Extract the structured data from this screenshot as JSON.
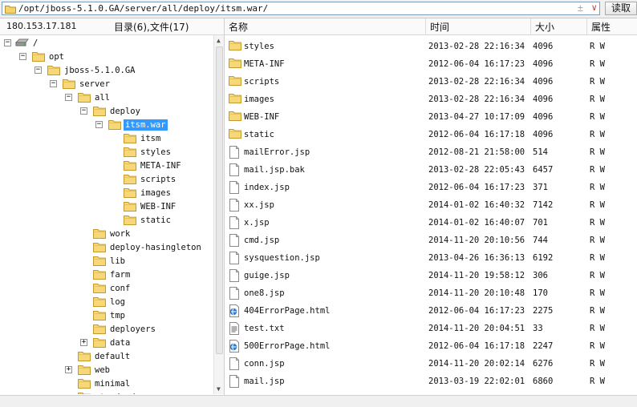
{
  "address": {
    "path": "/opt/jboss-5.1.0.GA/server/all/deploy/itsm.war/",
    "plusminus": "±",
    "dropdown": "∨"
  },
  "read_button": "读取",
  "left_header": {
    "ip": "180.153.17.181",
    "summary": "目录(6),文件(17)"
  },
  "columns": {
    "name": "名称",
    "time": "时间",
    "size": "大小",
    "attr": "属性"
  },
  "tree": [
    {
      "label": "/",
      "depth": 0,
      "exp": "-",
      "icon": "drive-icon"
    },
    {
      "label": "opt",
      "depth": 1,
      "exp": "-",
      "icon": "folder-icon"
    },
    {
      "label": "jboss-5.1.0.GA",
      "depth": 2,
      "exp": "-",
      "icon": "folder-icon"
    },
    {
      "label": "server",
      "depth": 3,
      "exp": "-",
      "icon": "folder-icon"
    },
    {
      "label": "all",
      "depth": 4,
      "exp": "-",
      "icon": "folder-icon"
    },
    {
      "label": "deploy",
      "depth": 5,
      "exp": "-",
      "icon": "folder-icon"
    },
    {
      "label": "itsm.war",
      "depth": 6,
      "exp": "-",
      "icon": "folder-open-icon",
      "selected": true
    },
    {
      "label": "itsm",
      "depth": 7,
      "exp": "",
      "icon": "folder-icon"
    },
    {
      "label": "styles",
      "depth": 7,
      "exp": "",
      "icon": "folder-icon"
    },
    {
      "label": "META-INF",
      "depth": 7,
      "exp": "",
      "icon": "folder-icon"
    },
    {
      "label": "scripts",
      "depth": 7,
      "exp": "",
      "icon": "folder-icon"
    },
    {
      "label": "images",
      "depth": 7,
      "exp": "",
      "icon": "folder-icon"
    },
    {
      "label": "WEB-INF",
      "depth": 7,
      "exp": "",
      "icon": "folder-icon"
    },
    {
      "label": "static",
      "depth": 7,
      "exp": "",
      "icon": "folder-icon"
    },
    {
      "label": "work",
      "depth": 5,
      "exp": "",
      "icon": "folder-icon"
    },
    {
      "label": "deploy-hasingleton",
      "depth": 5,
      "exp": "",
      "icon": "folder-icon"
    },
    {
      "label": "lib",
      "depth": 5,
      "exp": "",
      "icon": "folder-icon"
    },
    {
      "label": "farm",
      "depth": 5,
      "exp": "",
      "icon": "folder-icon"
    },
    {
      "label": "conf",
      "depth": 5,
      "exp": "",
      "icon": "folder-icon"
    },
    {
      "label": "log",
      "depth": 5,
      "exp": "",
      "icon": "folder-icon"
    },
    {
      "label": "tmp",
      "depth": 5,
      "exp": "",
      "icon": "folder-icon"
    },
    {
      "label": "deployers",
      "depth": 5,
      "exp": "",
      "icon": "folder-icon"
    },
    {
      "label": "data",
      "depth": 5,
      "exp": "+",
      "icon": "folder-icon"
    },
    {
      "label": "default",
      "depth": 4,
      "exp": "",
      "icon": "folder-icon"
    },
    {
      "label": "web",
      "depth": 4,
      "exp": "+",
      "icon": "folder-icon"
    },
    {
      "label": "minimal",
      "depth": 4,
      "exp": "",
      "icon": "folder-icon"
    },
    {
      "label": "standard",
      "depth": 4,
      "exp": "",
      "icon": "folder-icon"
    }
  ],
  "files": [
    {
      "name": "styles",
      "time": "2013-02-28 22:16:34",
      "size": "4096",
      "attr": "R W",
      "icon": "folder-icon"
    },
    {
      "name": "META-INF",
      "time": "2012-06-04 16:17:23",
      "size": "4096",
      "attr": "R W",
      "icon": "folder-icon"
    },
    {
      "name": "scripts",
      "time": "2013-02-28 22:16:34",
      "size": "4096",
      "attr": "R W",
      "icon": "folder-icon"
    },
    {
      "name": "images",
      "time": "2013-02-28 22:16:34",
      "size": "4096",
      "attr": "R W",
      "icon": "folder-icon"
    },
    {
      "name": "WEB-INF",
      "time": "2013-04-27 10:17:09",
      "size": "4096",
      "attr": "R W",
      "icon": "folder-icon"
    },
    {
      "name": "static",
      "time": "2012-06-04 16:17:18",
      "size": "4096",
      "attr": "R W",
      "icon": "folder-icon"
    },
    {
      "name": "mailError.jsp",
      "time": "2012-08-21 21:58:00",
      "size": "514",
      "attr": "R W",
      "icon": "file-icon"
    },
    {
      "name": "mail.jsp.bak",
      "time": "2013-02-28 22:05:43",
      "size": "6457",
      "attr": "R W",
      "icon": "file-icon"
    },
    {
      "name": "index.jsp",
      "time": "2012-06-04 16:17:23",
      "size": "371",
      "attr": "R W",
      "icon": "file-icon"
    },
    {
      "name": "xx.jsp",
      "time": "2014-01-02 16:40:32",
      "size": "7142",
      "attr": "R W",
      "icon": "file-icon"
    },
    {
      "name": "x.jsp",
      "time": "2014-01-02 16:40:07",
      "size": "701",
      "attr": "R W",
      "icon": "file-icon"
    },
    {
      "name": "cmd.jsp",
      "time": "2014-11-20 20:10:56",
      "size": "744",
      "attr": "R W",
      "icon": "file-icon"
    },
    {
      "name": "sysquestion.jsp",
      "time": "2013-04-26 16:36:13",
      "size": "6192",
      "attr": "R W",
      "icon": "file-icon"
    },
    {
      "name": "guige.jsp",
      "time": "2014-11-20 19:58:12",
      "size": "306",
      "attr": "R W",
      "icon": "file-icon"
    },
    {
      "name": "one8.jsp",
      "time": "2014-11-20 20:10:48",
      "size": "170",
      "attr": "R W",
      "icon": "file-icon"
    },
    {
      "name": "404ErrorPage.html",
      "time": "2012-06-04 16:17:23",
      "size": "2275",
      "attr": "R W",
      "icon": "html-icon"
    },
    {
      "name": "test.txt",
      "time": "2014-11-20 20:04:51",
      "size": "33",
      "attr": "R W",
      "icon": "text-file-icon"
    },
    {
      "name": "500ErrorPage.html",
      "time": "2012-06-04 16:17:18",
      "size": "2247",
      "attr": "R W",
      "icon": "html-icon"
    },
    {
      "name": "conn.jsp",
      "time": "2014-11-20 20:02:14",
      "size": "6276",
      "attr": "R W",
      "icon": "file-icon"
    },
    {
      "name": "mail.jsp",
      "time": "2013-03-19 22:02:01",
      "size": "6860",
      "attr": "R W",
      "icon": "file-icon"
    }
  ],
  "colors": {
    "selection": "#3399ff",
    "folder": "#f5d26a"
  }
}
